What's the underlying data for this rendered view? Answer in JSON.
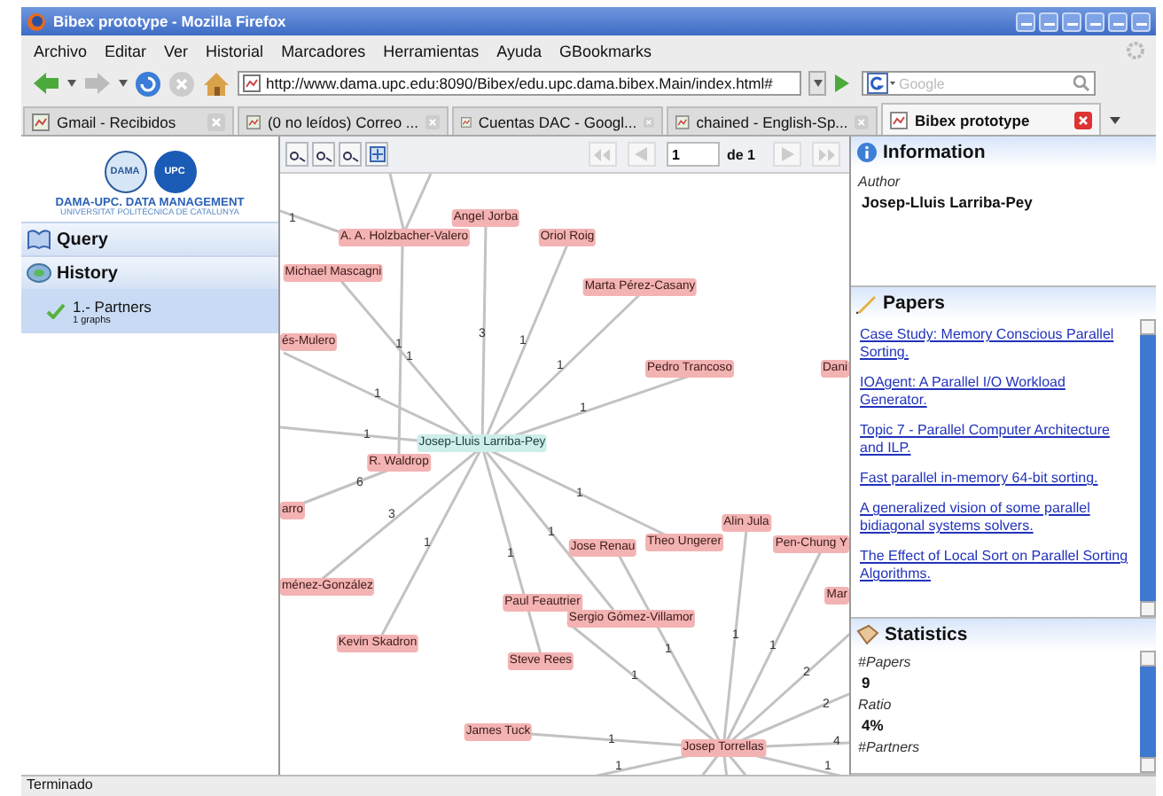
{
  "window": {
    "title": "Bibex prototype - Mozilla Firefox"
  },
  "menu": [
    "Archivo",
    "Editar",
    "Ver",
    "Historial",
    "Marcadores",
    "Herramientas",
    "Ayuda",
    "GBookmarks"
  ],
  "address_bar": {
    "value": "http://www.dama.upc.edu:8090/Bibex/edu.upc.dama.bibex.Main/index.html#"
  },
  "search": {
    "placeholder": "Google"
  },
  "tabs": [
    {
      "label": "Gmail - Recibidos",
      "selected": false
    },
    {
      "label": "(0 no leídos) Correo ...",
      "selected": false
    },
    {
      "label": "Cuentas DAC - Googl...",
      "selected": false
    },
    {
      "label": "chained - English-Sp...",
      "selected": false
    },
    {
      "label": "Bibex prototype",
      "selected": true
    }
  ],
  "sidebar": {
    "logo_left": "DAMA",
    "logo_right": "UPC",
    "logo_title": "DAMA-UPC. DATA MANAGEMENT",
    "logo_subtitle": "UNIVERSITAT POLITÈCNICA DE CATALUNYA",
    "sections": [
      {
        "title": "Query"
      },
      {
        "title": "History"
      }
    ],
    "history": [
      {
        "label": "1.- Partners",
        "detail": "1 graphs",
        "selected": true,
        "checked": true
      }
    ]
  },
  "graph": {
    "toolbar": {
      "page": "1",
      "page_total": "de 1"
    },
    "nodes": [
      {
        "label": "Angel Jorba",
        "kind": "author"
      },
      {
        "label": "A. A. Holzbacher-Valero",
        "kind": "author"
      },
      {
        "label": "Oriol Roig",
        "kind": "author"
      },
      {
        "label": "Michael Mascagni",
        "kind": "author"
      },
      {
        "label": "Marta Pérez-Casany",
        "kind": "author"
      },
      {
        "label": "és-Mulero",
        "kind": "author"
      },
      {
        "label": "Pedro Trancoso",
        "kind": "author"
      },
      {
        "label": "Dani",
        "kind": "author"
      },
      {
        "label": "Josep-Lluis Larriba-Pey",
        "kind": "center"
      },
      {
        "label": "R. Waldrop",
        "kind": "author"
      },
      {
        "label": "arro",
        "kind": "author"
      },
      {
        "label": "Alin Jula",
        "kind": "author"
      },
      {
        "label": "Jose Renau",
        "kind": "author"
      },
      {
        "label": "Theo Ungerer",
        "kind": "author"
      },
      {
        "label": "Pen-Chung Y",
        "kind": "author"
      },
      {
        "label": "ménez-González",
        "kind": "author"
      },
      {
        "label": "Mar",
        "kind": "author"
      },
      {
        "label": "Paul Feautrier",
        "kind": "author"
      },
      {
        "label": "Sergio Gómez-Villamor",
        "kind": "author"
      },
      {
        "label": "Kevin Skadron",
        "kind": "author"
      },
      {
        "label": "Steve Rees",
        "kind": "author"
      },
      {
        "label": "James Tuck",
        "kind": "author"
      },
      {
        "label": "Josep Torrellas",
        "kind": "author"
      }
    ],
    "edge_labels": [
      "3",
      "1",
      "1",
      "1",
      "1",
      "1",
      "1",
      "1",
      "6",
      "3",
      "1",
      "1",
      "1",
      "1",
      "1",
      "1",
      "1",
      "1",
      "2",
      "2",
      "4",
      "1",
      "1",
      "1",
      "1"
    ]
  },
  "info": {
    "title": "Information",
    "field": "Author",
    "value": "Josep-Lluis Larriba-Pey"
  },
  "papers": {
    "title": "Papers",
    "links": [
      "Case Study: Memory Conscious Parallel Sorting.",
      "IOAgent: A Parallel I/O Workload Generator.",
      "Topic 7 - Parallel Computer Architecture and ILP.",
      "Fast parallel in-memory 64-bit sorting.",
      "A generalized vision of some parallel bidiagonal systems solvers.",
      "The Effect of Local Sort on Parallel Sorting Algorithms."
    ]
  },
  "statistics": {
    "title": "Statistics",
    "items": [
      {
        "label": "#Papers",
        "value": "9"
      },
      {
        "label": "Ratio",
        "value": "4%"
      },
      {
        "label": "#Partners"
      }
    ]
  },
  "status_bar": "Terminado"
}
